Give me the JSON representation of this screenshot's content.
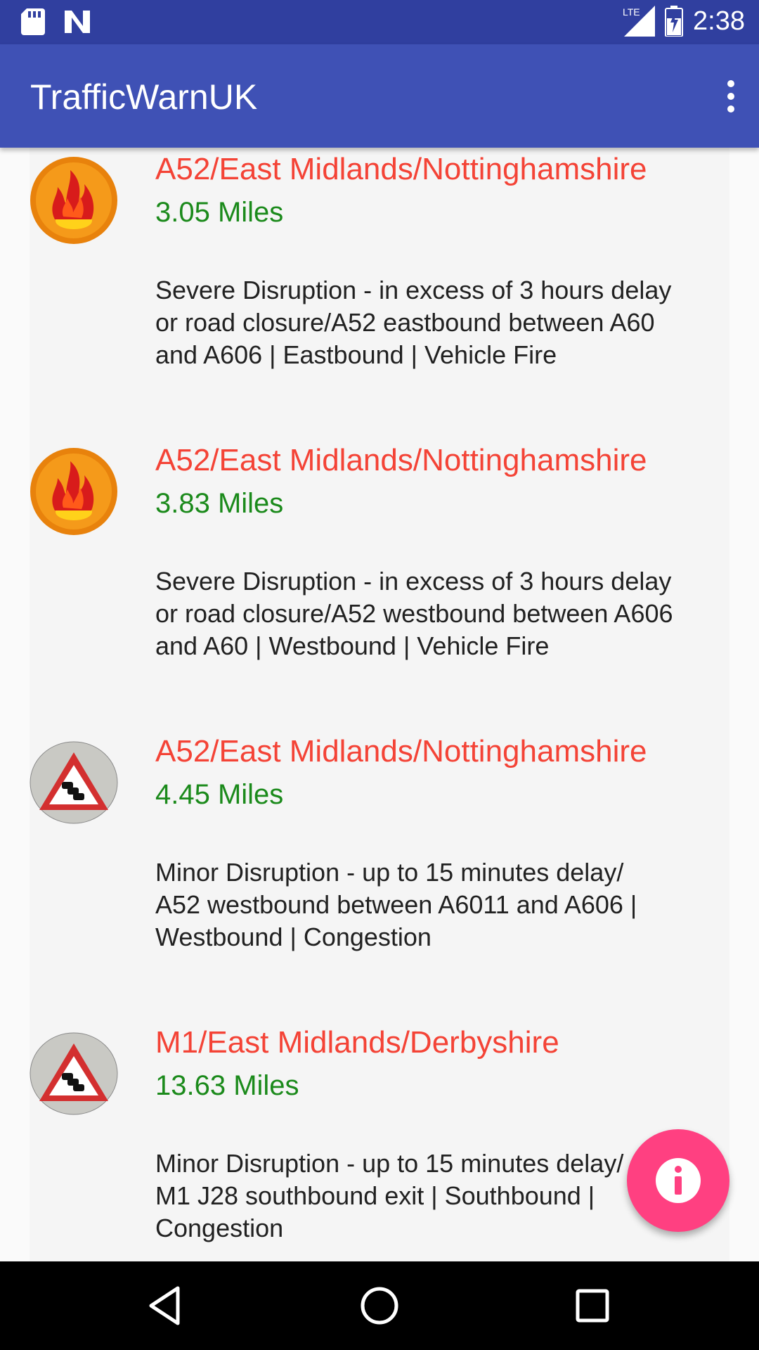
{
  "status_bar": {
    "time": "2:38",
    "network_label": "LTE",
    "icons": [
      "sd-card-icon",
      "n-notification-icon",
      "lte-signal-icon",
      "battery-icon"
    ]
  },
  "app_bar": {
    "title": "TrafficWarnUK",
    "overflow_icon": "more-vert-icon"
  },
  "items": [
    {
      "icon": "fire-icon",
      "title": "A52/East Midlands/Nottinghamshire",
      "distance": "3.05 Miles",
      "description": "Severe Disruption - in excess of 3 hours delay\nor road closure/A52 eastbound between A60\nand A606 | Eastbound | Vehicle Fire"
    },
    {
      "icon": "fire-icon",
      "title": "A52/East Midlands/Nottinghamshire",
      "distance": "3.83 Miles",
      "description": "Severe Disruption - in excess of 3 hours delay\nor road closure/A52 westbound between A606\nand A60 | Westbound | Vehicle Fire"
    },
    {
      "icon": "congestion-warning-icon",
      "title": "A52/East Midlands/Nottinghamshire",
      "distance": "4.45 Miles",
      "description": "Minor Disruption - up to 15 minutes delay/\nA52 westbound between A6011 and A606 |\nWestbound | Congestion"
    },
    {
      "icon": "congestion-warning-icon",
      "title": "M1/East Midlands/Derbyshire",
      "distance": "13.63 Miles",
      "description": "Minor Disruption - up to 15 minutes delay/\nM1 J28 southbound exit | Southbound |\nCongestion"
    }
  ],
  "fab": {
    "icon": "info-icon"
  },
  "nav_bar": {
    "icons": [
      "back-icon",
      "home-icon",
      "recents-icon"
    ]
  },
  "colors": {
    "status_bar": "#303f9f",
    "app_bar": "#3f51b5",
    "title_red": "#f44336",
    "distance_green": "#1b8a1b",
    "fab_pink": "#ff4081"
  }
}
